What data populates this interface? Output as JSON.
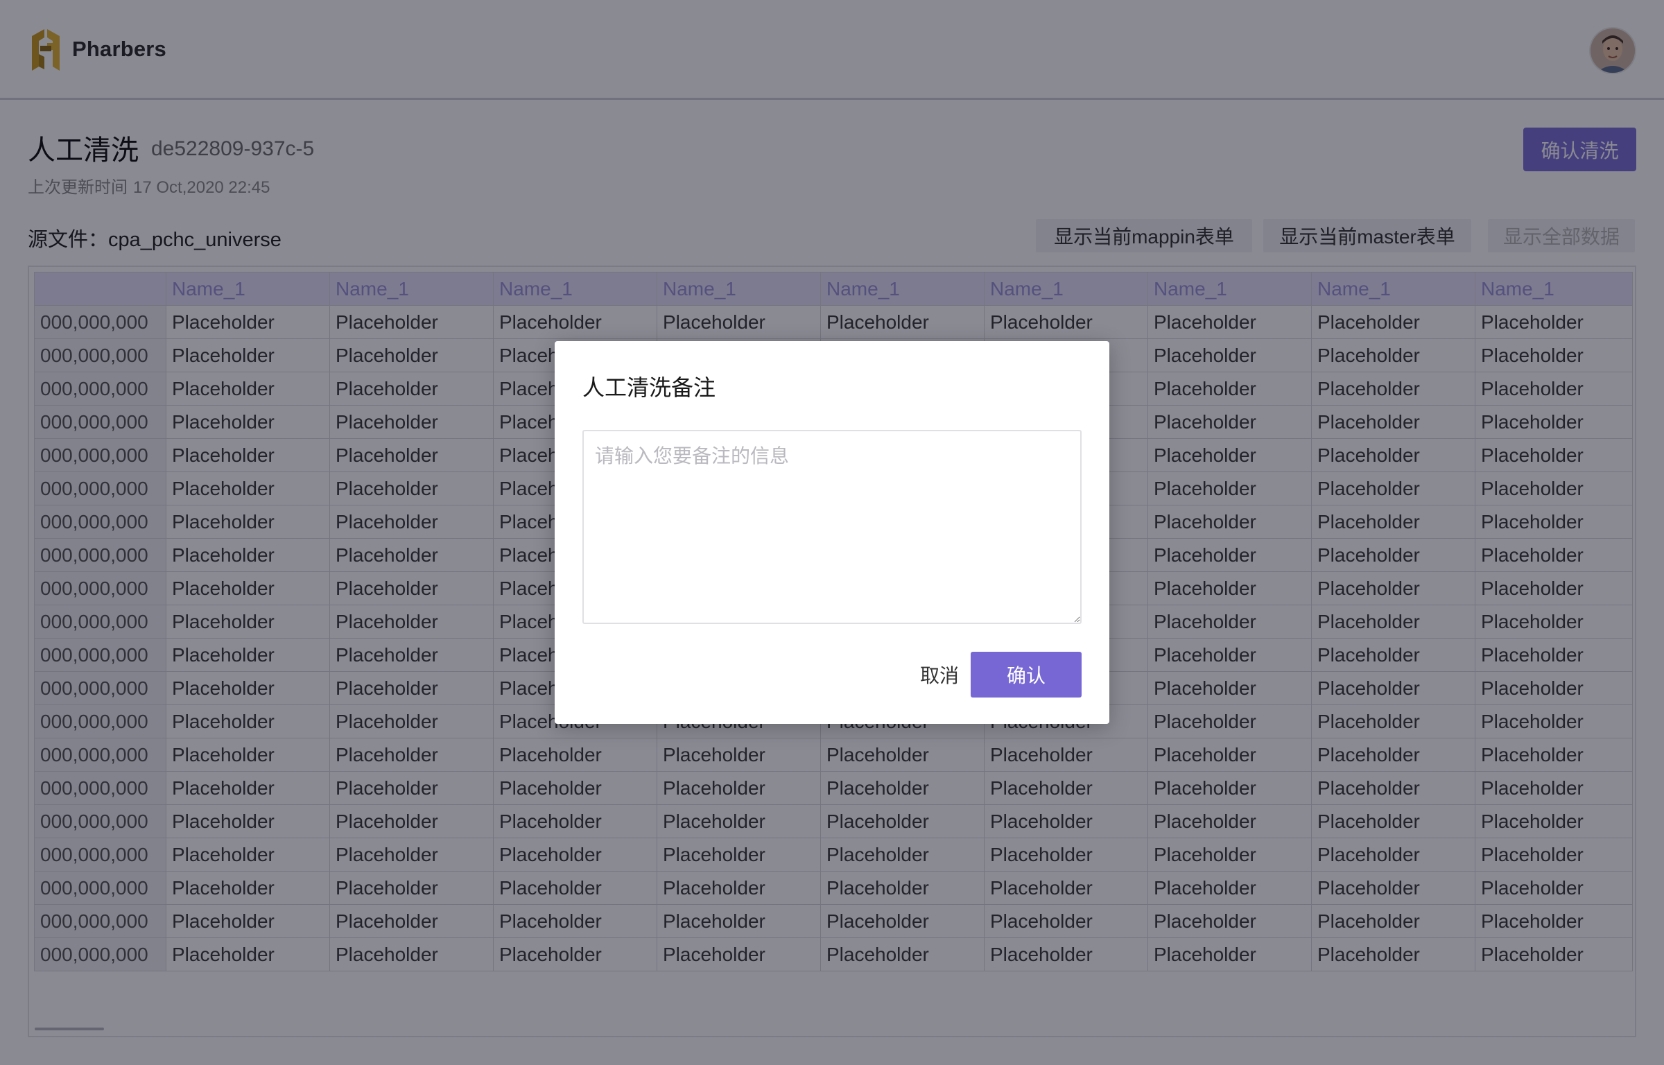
{
  "header": {
    "logo_text": "Pharbers",
    "brand_color": "#c79a1e",
    "avatar_icon": "user-avatar"
  },
  "page": {
    "title": "人工清洗",
    "job_id": "de522809-937c-5",
    "updated_label": "上次更新时间",
    "updated_value": "17 Oct,2020 22:45",
    "confirm_clean_label": "确认清洗",
    "source_label": "源文件：",
    "source_name": "cpa_pchc_universe",
    "actions": [
      {
        "label": "显示当前mappin表单",
        "disabled": false
      },
      {
        "label": "显示当前master表单",
        "disabled": false
      },
      {
        "label": "显示全部数据",
        "disabled": true
      }
    ],
    "accent_color": "#7b6fd6"
  },
  "table": {
    "columns": [
      "",
      "Name_1",
      "Name_1",
      "Name_1",
      "Name_1",
      "Name_1",
      "Name_1",
      "Name_1",
      "Name_1",
      "Name_1"
    ],
    "rows": [
      [
        "000,000,000",
        "Placeholder",
        "Placeholder",
        "Placeholder",
        "Placeholder",
        "Placeholder",
        "Placeholder",
        "Placeholder",
        "Placeholder",
        "Placeholder"
      ],
      [
        "000,000,000",
        "Placeholder",
        "Placeholder",
        "Placeholder",
        "Placeholder",
        "Placeholder",
        "Placeholder",
        "Placeholder",
        "Placeholder",
        "Placeholder"
      ],
      [
        "000,000,000",
        "Placeholder",
        "Placeholder",
        "Placeholder",
        "Placeholder",
        "Placeholder",
        "Placeholder",
        "Placeholder",
        "Placeholder",
        "Placeholder"
      ],
      [
        "000,000,000",
        "Placeholder",
        "Placeholder",
        "Placeholder",
        "Placeholder",
        "Placeholder",
        "Placeholder",
        "Placeholder",
        "Placeholder",
        "Placeholder"
      ],
      [
        "000,000,000",
        "Placeholder",
        "Placeholder",
        "Placeholder",
        "Placeholder",
        "Placeholder",
        "Placeholder",
        "Placeholder",
        "Placeholder",
        "Placeholder"
      ],
      [
        "000,000,000",
        "Placeholder",
        "Placeholder",
        "Placeholder",
        "Placeholder",
        "Placeholder",
        "Placeholder",
        "Placeholder",
        "Placeholder",
        "Placeholder"
      ],
      [
        "000,000,000",
        "Placeholder",
        "Placeholder",
        "Placeholder",
        "Placeholder",
        "Placeholder",
        "Placeholder",
        "Placeholder",
        "Placeholder",
        "Placeholder"
      ],
      [
        "000,000,000",
        "Placeholder",
        "Placeholder",
        "Placeholder",
        "Placeholder",
        "Placeholder",
        "Placeholder",
        "Placeholder",
        "Placeholder",
        "Placeholder"
      ],
      [
        "000,000,000",
        "Placeholder",
        "Placeholder",
        "Placeholder",
        "Placeholder",
        "Placeholder",
        "Placeholder",
        "Placeholder",
        "Placeholder",
        "Placeholder"
      ],
      [
        "000,000,000",
        "Placeholder",
        "Placeholder",
        "Placeholder",
        "Placeholder",
        "Placeholder",
        "Placeholder",
        "Placeholder",
        "Placeholder",
        "Placeholder"
      ],
      [
        "000,000,000",
        "Placeholder",
        "Placeholder",
        "Placeholder",
        "Placeholder",
        "Placeholder",
        "Placeholder",
        "Placeholder",
        "Placeholder",
        "Placeholder"
      ],
      [
        "000,000,000",
        "Placeholder",
        "Placeholder",
        "Placeholder",
        "Placeholder",
        "Placeholder",
        "Placeholder",
        "Placeholder",
        "Placeholder",
        "Placeholder"
      ],
      [
        "000,000,000",
        "Placeholder",
        "Placeholder",
        "Placeholder",
        "Placeholder",
        "Placeholder",
        "Placeholder",
        "Placeholder",
        "Placeholder",
        "Placeholder"
      ],
      [
        "000,000,000",
        "Placeholder",
        "Placeholder",
        "Placeholder",
        "Placeholder",
        "Placeholder",
        "Placeholder",
        "Placeholder",
        "Placeholder",
        "Placeholder"
      ],
      [
        "000,000,000",
        "Placeholder",
        "Placeholder",
        "Placeholder",
        "Placeholder",
        "Placeholder",
        "Placeholder",
        "Placeholder",
        "Placeholder",
        "Placeholder"
      ],
      [
        "000,000,000",
        "Placeholder",
        "Placeholder",
        "Placeholder",
        "Placeholder",
        "Placeholder",
        "Placeholder",
        "Placeholder",
        "Placeholder",
        "Placeholder"
      ],
      [
        "000,000,000",
        "Placeholder",
        "Placeholder",
        "Placeholder",
        "Placeholder",
        "Placeholder",
        "Placeholder",
        "Placeholder",
        "Placeholder",
        "Placeholder"
      ],
      [
        "000,000,000",
        "Placeholder",
        "Placeholder",
        "Placeholder",
        "Placeholder",
        "Placeholder",
        "Placeholder",
        "Placeholder",
        "Placeholder",
        "Placeholder"
      ],
      [
        "000,000,000",
        "Placeholder",
        "Placeholder",
        "Placeholder",
        "Placeholder",
        "Placeholder",
        "Placeholder",
        "Placeholder",
        "Placeholder",
        "Placeholder"
      ],
      [
        "000,000,000",
        "Placeholder",
        "Placeholder",
        "Placeholder",
        "Placeholder",
        "Placeholder",
        "Placeholder",
        "Placeholder",
        "Placeholder",
        "Placeholder"
      ]
    ]
  },
  "modal": {
    "title": "人工清洗备注",
    "textarea_placeholder": "请输入您要备注的信息",
    "textarea_value": "",
    "cancel_label": "取消",
    "confirm_label": "确认",
    "confirm_color": "#7767d4"
  }
}
